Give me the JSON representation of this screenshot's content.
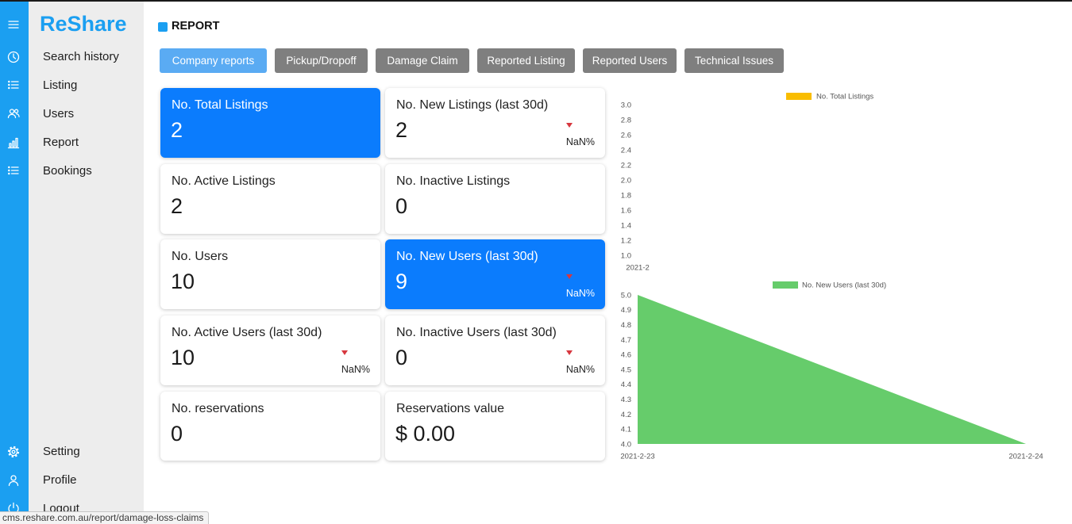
{
  "app": {
    "logo": "ReShare",
    "menu_icon": "menu-icon"
  },
  "sidebar": {
    "items": [
      {
        "label": "Search history",
        "icon": "clock-icon"
      },
      {
        "label": "Listing",
        "icon": "list-icon"
      },
      {
        "label": "Users",
        "icon": "users-icon"
      },
      {
        "label": "Report",
        "icon": "bar-chart-icon"
      },
      {
        "label": "Bookings",
        "icon": "list-icon"
      }
    ],
    "bottom_items": [
      {
        "label": "Setting",
        "icon": "gear-icon"
      },
      {
        "label": "Profile",
        "icon": "user-icon"
      },
      {
        "label": "Logout",
        "icon": "power-icon"
      }
    ]
  },
  "header": {
    "title": "REPORT"
  },
  "tabs": [
    {
      "label": "Company reports",
      "active": true
    },
    {
      "label": "Pickup/Dropoff",
      "active": false
    },
    {
      "label": "Damage Claim",
      "active": false
    },
    {
      "label": "Reported Listing",
      "active": false
    },
    {
      "label": "Reported Users",
      "active": false
    },
    {
      "label": "Technical Issues",
      "active": false
    }
  ],
  "cards": [
    {
      "title": "No. Total Listings",
      "value": "2",
      "highlight": true
    },
    {
      "title": "No. New Listings (last 30d)",
      "value": "2",
      "highlight": false,
      "trend_icon": "trend-down-icon",
      "change": "NaN%"
    },
    {
      "title": "No. Active Listings",
      "value": "2",
      "highlight": false
    },
    {
      "title": "No. Inactive Listings",
      "value": "0",
      "highlight": false
    },
    {
      "title": "No. Users",
      "value": "10",
      "highlight": false
    },
    {
      "title": "No. New Users (last 30d)",
      "value": "9",
      "highlight": true,
      "trend_icon": "trend-down-icon",
      "change": "NaN%"
    },
    {
      "title": "No. Active Users (last 30d)",
      "value": "10",
      "highlight": false,
      "trend_icon": "trend-down-icon",
      "change": "NaN%"
    },
    {
      "title": "No. Inactive Users (last 30d)",
      "value": "0",
      "highlight": false,
      "trend_icon": "trend-down-icon",
      "change": "NaN%"
    },
    {
      "title": "No. reservations",
      "value": "0",
      "highlight": false
    },
    {
      "title": "Reservations value",
      "value": "$ 0.00",
      "highlight": false
    }
  ],
  "chart_data": [
    {
      "type": "area",
      "categories": [
        "2021-2"
      ],
      "series": [
        {
          "name": "No. Total Listings",
          "values": [
            null
          ],
          "color": "#f9bd00"
        }
      ],
      "ylim": [
        1.0,
        3.0
      ],
      "yticks": [
        "3.0",
        "2.8",
        "2.6",
        "2.4",
        "2.2",
        "2.0",
        "1.8",
        "1.6",
        "1.4",
        "1.2",
        "1.0"
      ],
      "grid": false,
      "legend": "top"
    },
    {
      "type": "area",
      "categories": [
        "2021-2-23",
        "2021-2-24"
      ],
      "series": [
        {
          "name": "No. New Users (last 30d)",
          "values": [
            5.0,
            4.0
          ],
          "color": "#66cc6b"
        }
      ],
      "ylim": [
        4.0,
        5.0
      ],
      "yticks": [
        "5.0",
        "4.9",
        "4.8",
        "4.7",
        "4.6",
        "4.5",
        "4.4",
        "4.3",
        "4.2",
        "4.1",
        "4.0"
      ],
      "grid": false,
      "legend": "top"
    }
  ],
  "status_bar": {
    "url": "cms.reshare.com.au/report/damage-loss-claims"
  },
  "colors": {
    "brand": "#1b9ff1",
    "card_highlight": "#0b7cfd",
    "tab_active": "#5aabf3",
    "tab_inactive": "#7f7f7f",
    "trend_down": "#d7373f",
    "sidebar_bg": "#ededed"
  }
}
